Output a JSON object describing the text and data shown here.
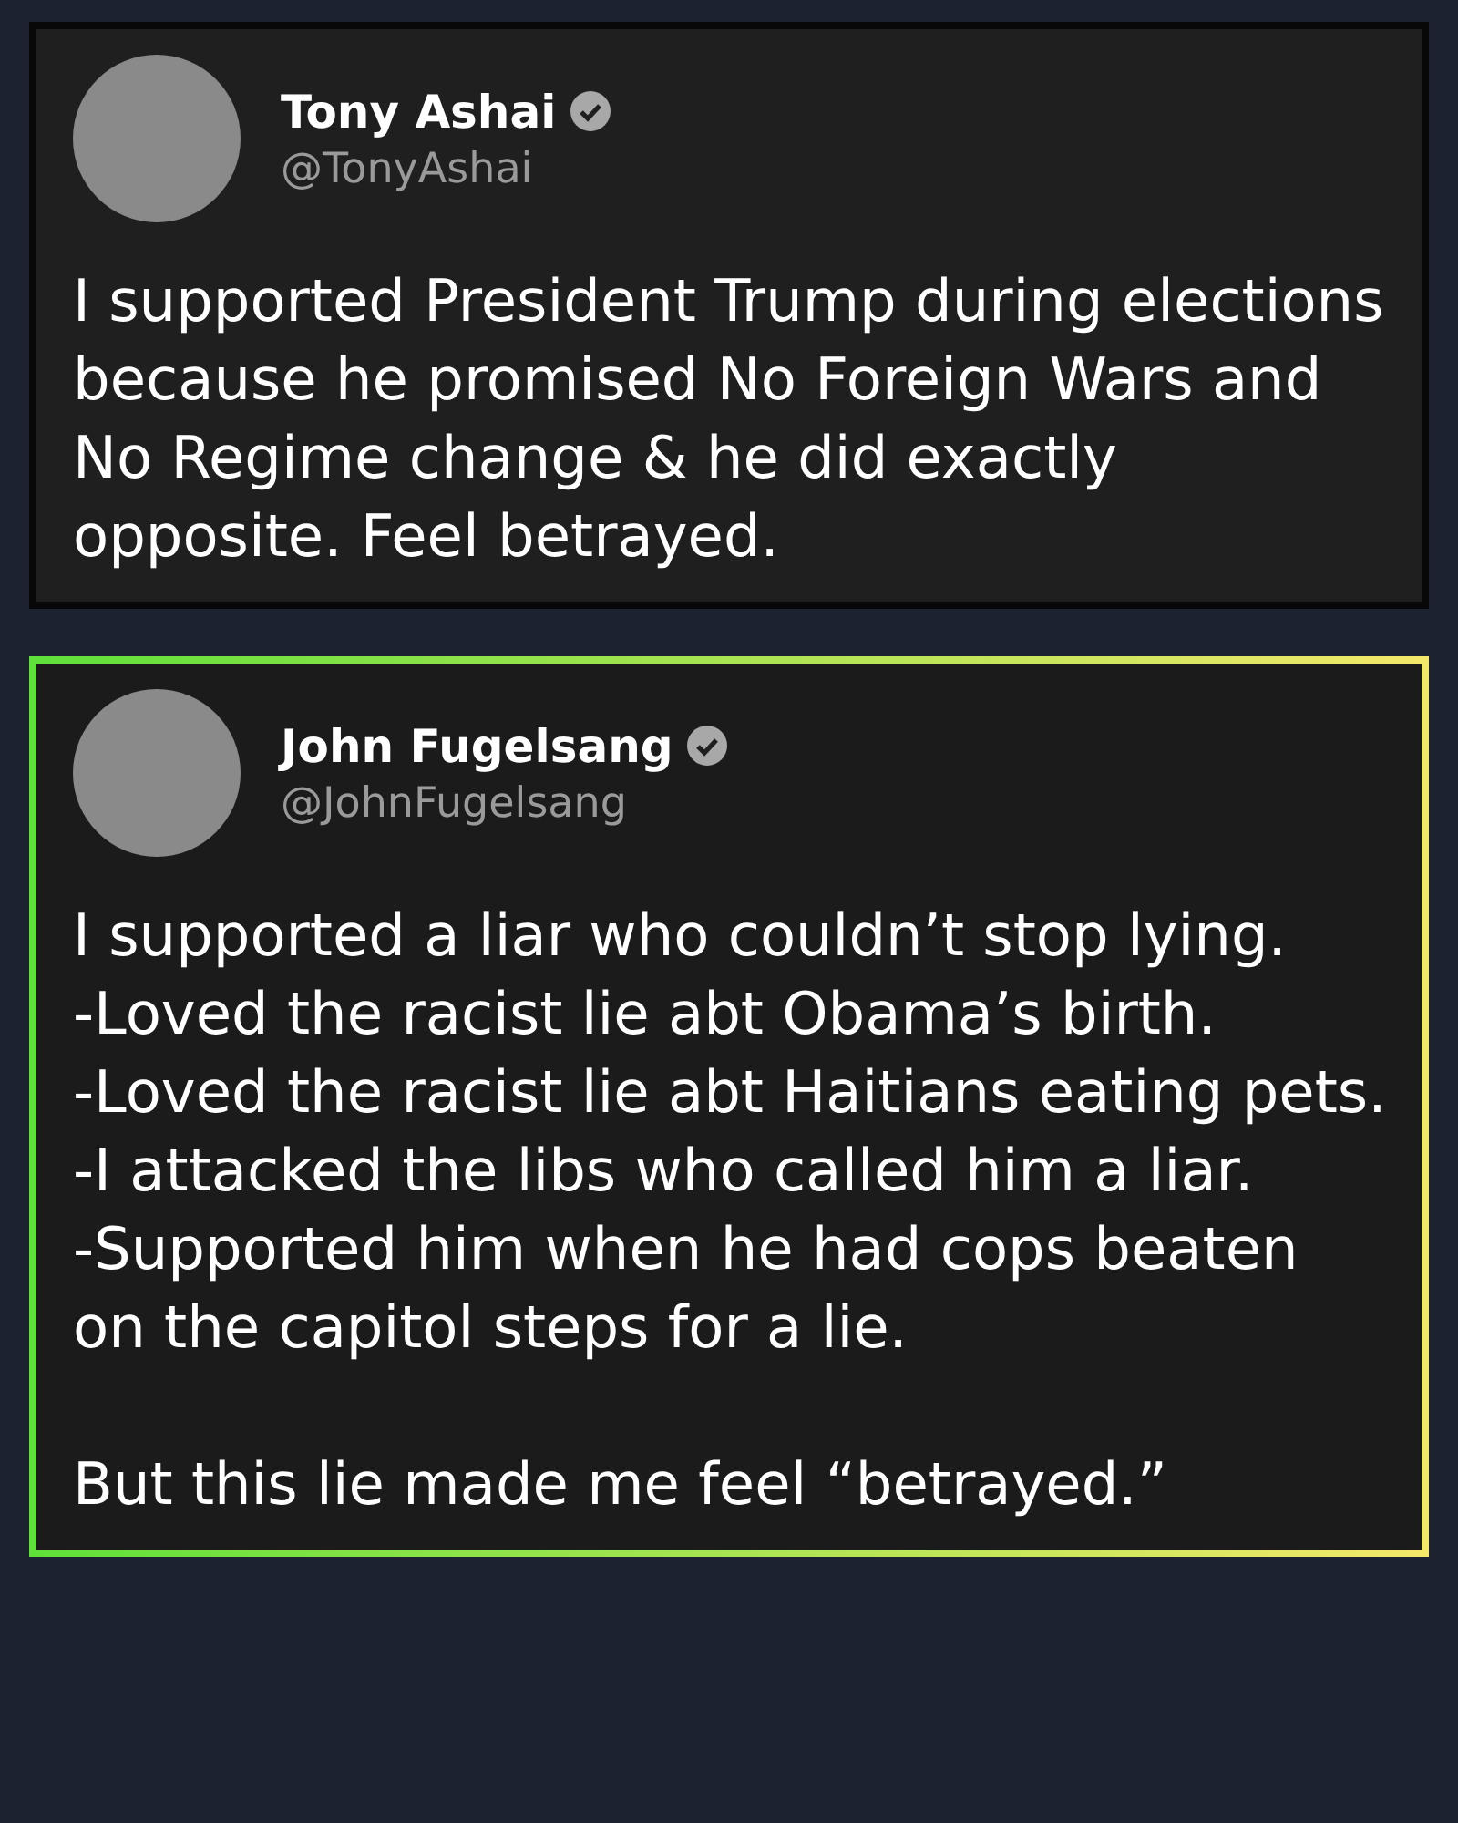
{
  "posts": [
    {
      "name": "Tony Ashai",
      "handle": "@TonyAshai",
      "verified": true,
      "kind": "plain",
      "paragraphs": [
        "I supported President Trump during elections because he promised No Foreign Wars and No Regime change & he did exactly opposite. Feel betrayed."
      ]
    },
    {
      "name": "John Fugelsang",
      "handle": "@JohnFugelsang",
      "verified": true,
      "kind": "highlighted",
      "paragraphs": [
        "I supported a liar who couldn’t stop lying.",
        "-Loved the racist lie abt Obama’s birth.",
        "-Loved the racist lie abt Haitians eating pets.",
        "-I attacked the libs who called him a liar.",
        "-Supported him when he had cops beaten on the capitol steps for a lie."
      ],
      "closing": "But this lie made me feel “betrayed.”"
    }
  ]
}
